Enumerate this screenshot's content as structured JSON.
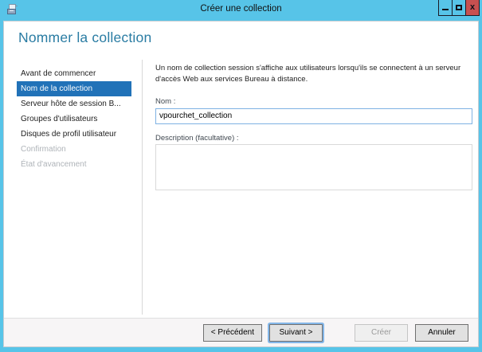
{
  "window": {
    "title": "Créer une collection",
    "control_icons": [
      "minimize-icon",
      "maximize-icon",
      "close-icon"
    ],
    "close_glyph": "x"
  },
  "page": {
    "heading": "Nommer la collection"
  },
  "sidebar": {
    "items": [
      {
        "label": "Avant de commencer",
        "state": "normal"
      },
      {
        "label": "Nom de la collection",
        "state": "selected"
      },
      {
        "label": "Serveur hôte de session B...",
        "state": "normal"
      },
      {
        "label": "Groupes d'utilisateurs",
        "state": "normal"
      },
      {
        "label": "Disques de profil utilisateur",
        "state": "normal"
      },
      {
        "label": "Confirmation",
        "state": "disabled"
      },
      {
        "label": "État d'avancement",
        "state": "disabled"
      }
    ]
  },
  "content": {
    "description": "Un nom de collection session s'affiche aux utilisateurs lorsqu'ils se connectent à un serveur d'accès Web aux services Bureau à distance.",
    "name_label": "Nom :",
    "name_value": "vpourchet_collection",
    "description_label": "Description (facultative) :",
    "description_value": ""
  },
  "footer": {
    "buttons": [
      {
        "label": "< Précédent",
        "state": "enabled"
      },
      {
        "label": "Suivant >",
        "state": "focused"
      },
      {
        "label": "Créer",
        "state": "disabled"
      },
      {
        "label": "Annuler",
        "state": "enabled"
      }
    ]
  },
  "colors": {
    "titlebar": "#57C4E8",
    "close_button": "#C75050",
    "selected_item": "#2172B8",
    "heading": "#2A7CA3",
    "focus_ring": "#84B6E8",
    "footer_bg": "#F7F5F6"
  }
}
